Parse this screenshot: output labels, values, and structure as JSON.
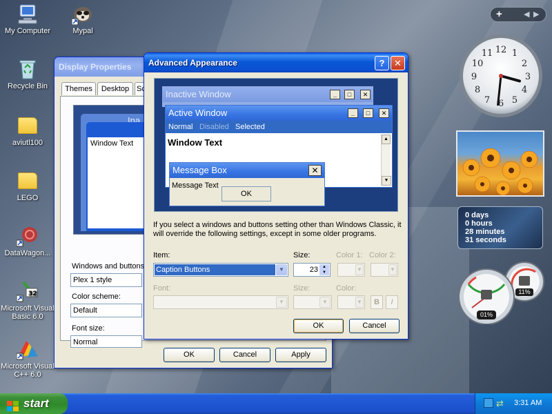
{
  "desktop": {
    "icons": [
      {
        "label": "My Computer"
      },
      {
        "label": "Mypal"
      },
      {
        "label": "Recycle Bin"
      },
      {
        "label": "aviutl100"
      },
      {
        "label": "LEGO"
      },
      {
        "label": "DataWagon..."
      },
      {
        "label": "Microsoft Visual Basic 6.0"
      },
      {
        "label": "Microsoft Visual C++ 6.0"
      }
    ]
  },
  "display_properties": {
    "title": "Display Properties",
    "tabs": [
      "Themes",
      "Desktop",
      "Sc"
    ],
    "preview": {
      "inactive_caption": "Ina",
      "window_text": "Window Text"
    },
    "windows_buttons_label": "Windows and buttons:",
    "windows_buttons_value": "Plex 1 style",
    "color_scheme_label": "Color scheme:",
    "color_scheme_value": "Default",
    "font_size_label": "Font size:",
    "font_size_value": "Normal",
    "ok": "OK",
    "cancel": "Cancel",
    "apply": "Apply"
  },
  "advanced": {
    "title": "Advanced Appearance",
    "help_glyph": "?",
    "close_glyph": "✕",
    "preview": {
      "inactive_window": "Inactive Window",
      "active_window": "Active Window",
      "menu_normal": "Normal",
      "menu_disabled": "Disabled",
      "menu_selected": "Selected",
      "window_text": "Window Text",
      "message_box": "Message Box",
      "message_text": "Message Text",
      "ok": "OK"
    },
    "info_text": "If you select a windows and buttons setting other than Windows Classic, it will override the following settings, except in some older programs.",
    "item_label": "Item:",
    "item_value": "Caption Buttons",
    "size_label": "Size:",
    "size_value": "23",
    "color1_label": "Color 1:",
    "color2_label": "Color 2:",
    "font_label": "Font:",
    "font_size_label": "Size:",
    "font_color_label": "Color:",
    "bold_glyph": "B",
    "italic_glyph": "I",
    "ok": "OK",
    "cancel": "Cancel"
  },
  "gadgets": {
    "uptime": [
      "0 days",
      "0 hours",
      "28 minutes",
      "31 seconds"
    ],
    "cpu_percent": "01%",
    "mem_percent": "11%",
    "clock": {
      "hour": 3,
      "minute": 31
    }
  },
  "taskbar": {
    "start": "start",
    "time": "3:31 AM"
  },
  "colors": {
    "accent_blue": "#0a58d6",
    "selection_blue": "#316ac5"
  }
}
